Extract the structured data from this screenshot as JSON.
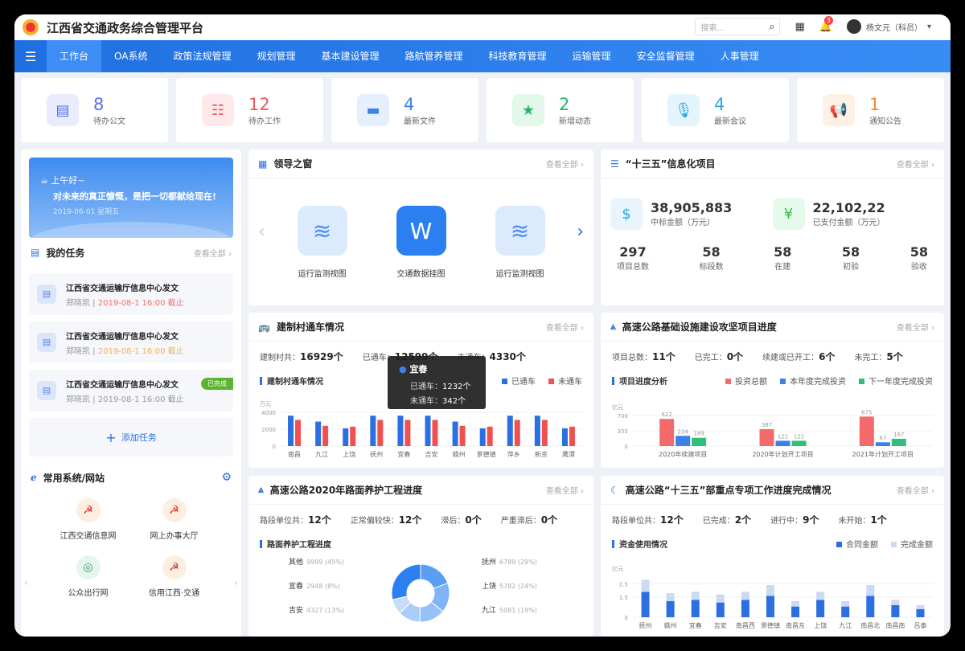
{
  "app": {
    "title": "江西省交通政务综合管理平台",
    "search_placeholder": "搜索...",
    "notif_count": "3",
    "user": "杨文元（科员）"
  },
  "nav": [
    "工作台",
    "OA系统",
    "政策法规管理",
    "规划管理",
    "基本建设管理",
    "路航管养管理",
    "科技教育管理",
    "运输管理",
    "安全监督管理",
    "人事管理"
  ],
  "stats": [
    {
      "num": "8",
      "label": "待办公文",
      "color": "#5b6ee8",
      "bg": "#e9ecfd",
      "icon": "document-icon"
    },
    {
      "num": "12",
      "label": "待办工作",
      "color": "#f05a5a",
      "bg": "#fde9e9",
      "icon": "task-icon"
    },
    {
      "num": "4",
      "label": "最新文件",
      "color": "#3b82e8",
      "bg": "#e6f0fd",
      "icon": "folder-icon"
    },
    {
      "num": "2",
      "label": "新增动态",
      "color": "#27b56a",
      "bg": "#e3f7ea",
      "icon": "star-icon"
    },
    {
      "num": "4",
      "label": "最新会议",
      "color": "#2aa8e0",
      "bg": "#e3f4fc",
      "icon": "microphone-icon"
    },
    {
      "num": "1",
      "label": "通知公告",
      "color": "#f08a3a",
      "bg": "#fdf0e4",
      "icon": "megaphone-icon"
    }
  ],
  "greeting": {
    "hello": "上午好~",
    "motto": "对未来的真正慷慨，是把一切都献给现在!",
    "date": "2019-06-01  星期五"
  },
  "tasks": {
    "title": "我的任务",
    "more": "查看全部",
    "add": "添加任务",
    "items": [
      {
        "title": "江西省交通运输厅信息中心发文",
        "owner": "郑晓凯 | ",
        "deadline": "2019-08-1 16:00 截止",
        "color": "#f07070",
        "done": ""
      },
      {
        "title": "江西省交通运输厅信息中心发文",
        "owner": "郑晓凯 | ",
        "deadline": "2019-08-1 16:00 截止",
        "color": "#f0b060",
        "done": ""
      },
      {
        "title": "江西省交通运输厅信息中心发文",
        "owner": "郑晓凯 | ",
        "deadline": "2019-08-1 16:00 截止",
        "color": "#999999",
        "done": "已完成"
      }
    ]
  },
  "sites": {
    "title": "常用系统/网站",
    "items": [
      "江西交通信息网",
      "网上办事大厅",
      "公众出行网",
      "信用江西·交通"
    ]
  },
  "leader": {
    "title": "领导之窗",
    "more": "查看全部",
    "items": [
      "运行监测视图",
      "交通数据挂图",
      "运行监测视图"
    ]
  },
  "info": {
    "title": "“十三五”信息化项目",
    "more": "查看全部",
    "a_num": "38,905,883",
    "a_label": "中标金额（万元）",
    "b_num": "22,102,22",
    "b_label": "已支付金额（万元）",
    "counts": [
      {
        "n": "297",
        "l": "项目总数"
      },
      {
        "n": "58",
        "l": "标段数"
      },
      {
        "n": "58",
        "l": "在建"
      },
      {
        "n": "58",
        "l": "初验"
      },
      {
        "n": "58",
        "l": "验收"
      }
    ]
  },
  "village": {
    "title": "建制村通车情况",
    "more": "查看全部",
    "kv": [
      {
        "k": "建制村共：",
        "v": "16929个"
      },
      {
        "k": "已通车：",
        "v": "12599个"
      },
      {
        "k": "未通车：",
        "v": "4330个"
      }
    ],
    "sub": "建制村通车情况",
    "tooltip": {
      "name": "宜春",
      "l1": "已通车：",
      "v1": "1232个",
      "l2": "未通车：",
      "v2": "342个"
    }
  },
  "highway": {
    "title": "高速公路基础设施建设攻坚项目进度",
    "more": "查看全部",
    "kv": [
      {
        "k": "项目总数：",
        "v": "11个"
      },
      {
        "k": "已完工：",
        "v": "0个"
      },
      {
        "k": "续建或已开工：",
        "v": "6个"
      },
      {
        "k": "未完工：",
        "v": "5个"
      }
    ],
    "sub": "项目进度分析"
  },
  "pavement": {
    "title": "高速公路2020年路面养护工程进度",
    "more": "查看全部",
    "kv": [
      {
        "k": "路段单位共：",
        "v": "12个"
      },
      {
        "k": "正常偏较快：",
        "v": "12个"
      },
      {
        "k": "滞后：",
        "v": "0个"
      },
      {
        "k": "严重滞后：",
        "v": "0个"
      }
    ],
    "sub": "路面养护工程进度"
  },
  "special": {
    "title": "高速公路“十三五”部重点专项工作进度完成情况",
    "more": "查看全部",
    "kv": [
      {
        "k": "路段单位共：",
        "v": "12个"
      },
      {
        "k": "已完成：",
        "v": "2个"
      },
      {
        "k": "进行中：",
        "v": "9个"
      },
      {
        "k": "未开始：",
        "v": "1个"
      }
    ],
    "sub": "资金使用情况"
  },
  "chart_data": [
    {
      "type": "bar",
      "ylabel": "万元",
      "ylim": [
        0,
        4000
      ],
      "yticks": [
        0,
        2000,
        4000
      ],
      "categories": [
        "南昌",
        "九江",
        "上饶",
        "抚州",
        "宜春",
        "吉安",
        "赣州",
        "景德镇",
        "萍乡",
        "新余",
        "鹰潭"
      ],
      "series": [
        {
          "name": "已通车",
          "color": "#2b6fe0",
          "values": [
            3600,
            2900,
            2100,
            3600,
            3600,
            3600,
            2900,
            2100,
            3600,
            3600,
            2100
          ]
        },
        {
          "name": "未通车",
          "color": "#f05050",
          "values": [
            3100,
            2400,
            2300,
            3100,
            3100,
            3100,
            2400,
            2300,
            3100,
            3100,
            2300
          ]
        }
      ]
    },
    {
      "type": "bar",
      "ylabel": "亿元",
      "ylim": [
        0,
        700
      ],
      "yticks": [
        0,
        350,
        700
      ],
      "categories": [
        "2020年续建项目",
        "2020年计划开工项目",
        "2021年计划开工项目"
      ],
      "series": [
        {
          "name": "投资总额",
          "color": "#f46a6a",
          "values": [
            622,
            387,
            675
          ]
        },
        {
          "name": "本年度完成投资",
          "color": "#3b82e8",
          "values": [
            234,
            121,
            87
          ]
        },
        {
          "name": "下一年度完成投资",
          "color": "#2fbf7a",
          "values": [
            189,
            121,
            167
          ]
        }
      ]
    },
    {
      "type": "pie",
      "donut": true,
      "slices": [
        {
          "label": "其他",
          "value": 9999,
          "pct": "45%"
        },
        {
          "label": "宜春",
          "value": 2948,
          "pct": "8%"
        },
        {
          "label": "吉安",
          "value": 4327,
          "pct": "13%"
        },
        {
          "label": "抚州",
          "value": 6789,
          "pct": "29%"
        },
        {
          "label": "上饶",
          "value": 5782,
          "pct": "24%"
        },
        {
          "label": "九江",
          "value": 5081,
          "pct": "19%"
        }
      ]
    },
    {
      "type": "bar",
      "stacked": true,
      "ylabel": "亿元",
      "ylim": [
        0,
        3
      ],
      "yticks": [
        0,
        1.5,
        2.5
      ],
      "categories": [
        "抚州",
        "赣州",
        "宜春",
        "吉安",
        "南昌西",
        "景德镇",
        "南昌东",
        "上饶",
        "九江",
        "南昌北",
        "南昌南",
        "吕泰"
      ],
      "series": [
        {
          "name": "合同金额",
          "color": "#2b6fe0",
          "values": [
            1.9,
            1.2,
            1.3,
            1.1,
            1.3,
            1.6,
            0.8,
            1.3,
            0.8,
            1.6,
            0.9,
            0.6
          ]
        },
        {
          "name": "完成金额",
          "color": "#c9daf5",
          "values": [
            0.9,
            0.6,
            0.6,
            0.6,
            0.6,
            0.8,
            0.4,
            0.6,
            0.4,
            0.8,
            0.4,
            0.3
          ]
        }
      ]
    }
  ]
}
